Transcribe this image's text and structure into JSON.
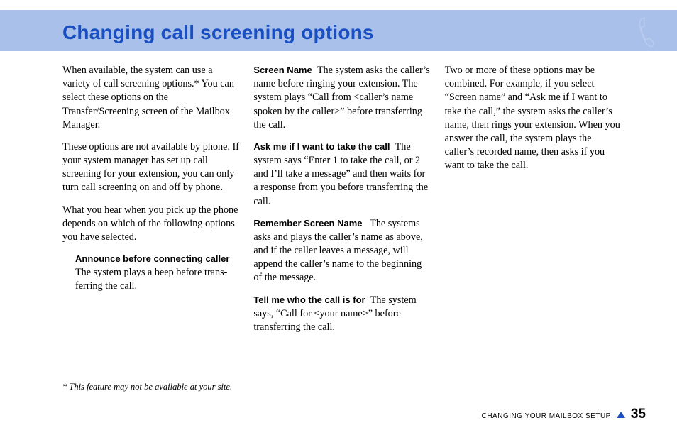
{
  "title": "Changing call screening options",
  "col1": {
    "p1": "When available, the system can use a variety of call screening options.* You can select these options on the Transfer/Screening screen of the Mailbox Man­ager.",
    "p2": "These options are not available by phone. If your system manager has set up call screening for your extension, you can only turn call screening on and off by phone.",
    "p3": "What you hear when you pick up the phone depends on which of the follow­ing options you have selected.",
    "opt1": {
      "label": "Announce before connecting caller",
      "desc": "The system plays a beep before trans­ferring the call."
    }
  },
  "col2": {
    "opt1": {
      "label": "Screen Name",
      "desc": "The system asks the caller’s name before ringing your extension. The system plays “Call from <caller’s name spoken by the caller>” before transferring the call."
    },
    "opt2": {
      "label": "Ask me if I want to take the call",
      "desc": "The system says “Enter 1 to take the call, or 2 and I’ll take a message” and then waits for a response from you before transferring the call."
    },
    "opt3": {
      "label": "Remember Screen Name",
      "desc": "The sys­tems asks and plays the caller’s name as above, and if the caller leaves a message, will append the caller’s name to the beginning of the mes­sage."
    },
    "opt4": {
      "label": "Tell me who the call is for",
      "desc": "The sys­tem says, “Call for <your name>” before transferring the call."
    }
  },
  "col3": {
    "p1": "Two or more of these options may be combined. For example, if you select “Screen name” and “Ask me if I want to take the call,” the system asks the caller’s name, then rings your extension. When you answer the call, the system plays the caller’s recorded name, then asks if you want to take the call."
  },
  "footnote": "* This feature may not be available at your site.",
  "footer": {
    "section": "CHANGING YOUR MAILBOX SETUP",
    "page": "35"
  }
}
